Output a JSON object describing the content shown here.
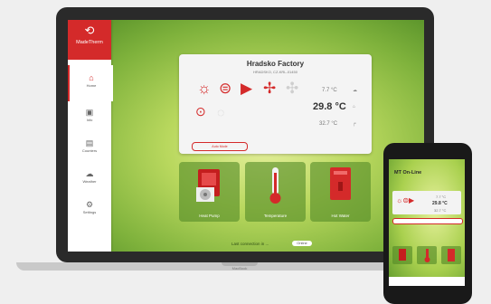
{
  "brand": {
    "name": "MadeTherm",
    "logo_icon": "madetherm-logo-icon"
  },
  "sidebar": {
    "items": [
      {
        "label": "Home",
        "icon": "home-icon"
      },
      {
        "label": "Info",
        "icon": "info-icon"
      },
      {
        "label": "Counters",
        "icon": "counters-icon"
      },
      {
        "label": "Weather",
        "icon": "weather-icon"
      },
      {
        "label": "Settings",
        "icon": "settings-icon"
      }
    ]
  },
  "status": {
    "title": "Hradsko Factory",
    "subtitle": "HRADSKO, CZ-KRL-01450",
    "temps": [
      {
        "value": "7.7 °C"
      },
      {
        "value": "29.8 °C"
      },
      {
        "value": "32.7 °C"
      }
    ],
    "mode_button": "Auto Mode"
  },
  "tiles": [
    {
      "label": "Heat Pump"
    },
    {
      "label": "Temperature"
    },
    {
      "label": "Hot Water"
    }
  ],
  "footer": {
    "text": "Last connection in ...",
    "badge": "Online"
  },
  "laptop": {
    "label": "MacBook"
  },
  "phone": {
    "title": "MT On-Line"
  },
  "colors": {
    "accent": "#d42a2a",
    "tile": "#568c28"
  }
}
